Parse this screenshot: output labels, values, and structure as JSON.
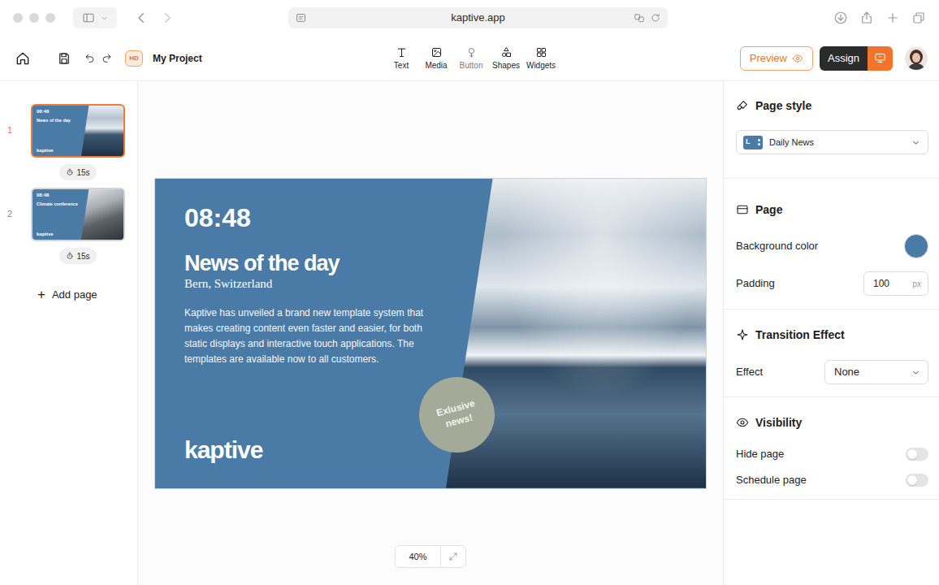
{
  "browser": {
    "address": "kaptive.app"
  },
  "toolbar": {
    "badge": "HD",
    "project": "My Project",
    "tools": [
      {
        "label": "Text",
        "disabled": false
      },
      {
        "label": "Media",
        "disabled": false
      },
      {
        "label": "Button",
        "disabled": true
      },
      {
        "label": "Shapes",
        "disabled": false
      },
      {
        "label": "Widgets",
        "disabled": false
      }
    ],
    "preview": "Preview",
    "assign": "Assign"
  },
  "pages": [
    {
      "number": "1",
      "selected": true,
      "duration": "15s",
      "thumb": {
        "time": "08:48",
        "title": "News of the day",
        "logo": "kaptive"
      }
    },
    {
      "number": "2",
      "selected": false,
      "duration": "15s",
      "thumb": {
        "time": "08:48",
        "title": "Climate conference",
        "logo": "kaptive"
      }
    }
  ],
  "add_page": {
    "icon": "+",
    "label": "Add page"
  },
  "slide": {
    "time": "08:48",
    "title": "News of the day",
    "location": "Bern, Switzerland",
    "body": "Kaptive has unveiled a brand new template system that makes creating content even faster and easier, for both static displays and interactive touch applications. The templates are available now to all customers.",
    "badge": "Exlusive news!",
    "logo": "kaptive"
  },
  "zoom": "40%",
  "panel": {
    "page_style": {
      "title": "Page style",
      "badge": "L",
      "value": "Daily News"
    },
    "page": {
      "title": "Page",
      "background_label": "Background color",
      "background_color": "#4a7ba6",
      "padding_label": "Padding",
      "padding_value": "100",
      "padding_unit": "px"
    },
    "transition": {
      "title": "Transition Effect",
      "effect_label": "Effect",
      "effect_value": "None"
    },
    "visibility": {
      "title": "Visibility",
      "toggles": [
        {
          "label": "Hide page",
          "on": false
        },
        {
          "label": "Schedule page",
          "on": false
        }
      ]
    }
  }
}
